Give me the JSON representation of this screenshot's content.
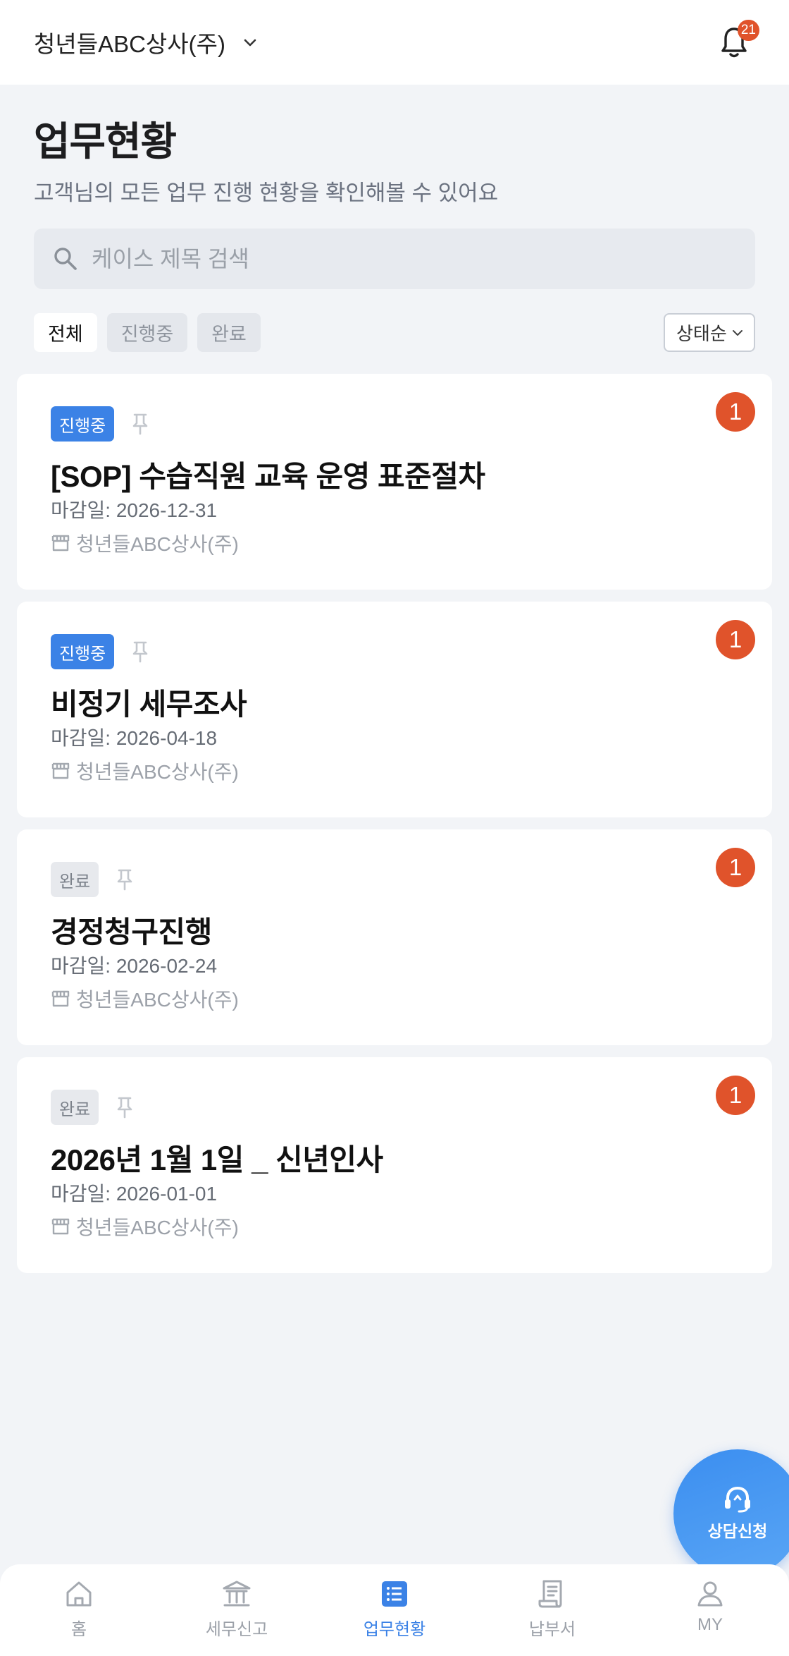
{
  "header": {
    "company": "청년들ABC상사(주)",
    "notification_count": "21"
  },
  "page": {
    "title": "업무현황",
    "subtitle": "고객님의 모든 업무 진행 현황을 확인해볼 수 있어요"
  },
  "search": {
    "placeholder": "케이스 제목 검색",
    "value": ""
  },
  "filters": [
    {
      "label": "전체",
      "active": true
    },
    {
      "label": "진행중",
      "active": false
    },
    {
      "label": "완료",
      "active": false
    }
  ],
  "sort": {
    "label": "상태순"
  },
  "cases": [
    {
      "status": "진행중",
      "status_type": "progress",
      "title": "[SOP] 수습직원 교육 운영 표준절차",
      "due": "마감일: 2026-12-31",
      "company": "청년들ABC상사(주)",
      "count": "1"
    },
    {
      "status": "진행중",
      "status_type": "progress",
      "title": "비정기 세무조사",
      "due": "마감일: 2026-04-18",
      "company": "청년들ABC상사(주)",
      "count": "1"
    },
    {
      "status": "완료",
      "status_type": "done",
      "title": "경정청구진행",
      "due": "마감일: 2026-02-24",
      "company": "청년들ABC상사(주)",
      "count": "1"
    },
    {
      "status": "완료",
      "status_type": "done",
      "title": "2026년 1월 1일 _ 신년인사",
      "due": "마감일: 2026-01-01",
      "company": "청년들ABC상사(주)",
      "count": "1"
    }
  ],
  "fab": {
    "label": "상담신청",
    "icon": "headset-icon"
  },
  "nav": [
    {
      "label": "홈",
      "icon": "home-icon",
      "active": false
    },
    {
      "label": "세무신고",
      "icon": "bank-icon",
      "active": false
    },
    {
      "label": "업무현황",
      "icon": "list-icon",
      "active": true
    },
    {
      "label": "납부서",
      "icon": "receipt-icon",
      "active": false
    },
    {
      "label": "MY",
      "icon": "person-icon",
      "active": false
    }
  ],
  "colors": {
    "accent": "#3b82e6",
    "badge": "#e0532b",
    "background": "#f2f4f7"
  }
}
